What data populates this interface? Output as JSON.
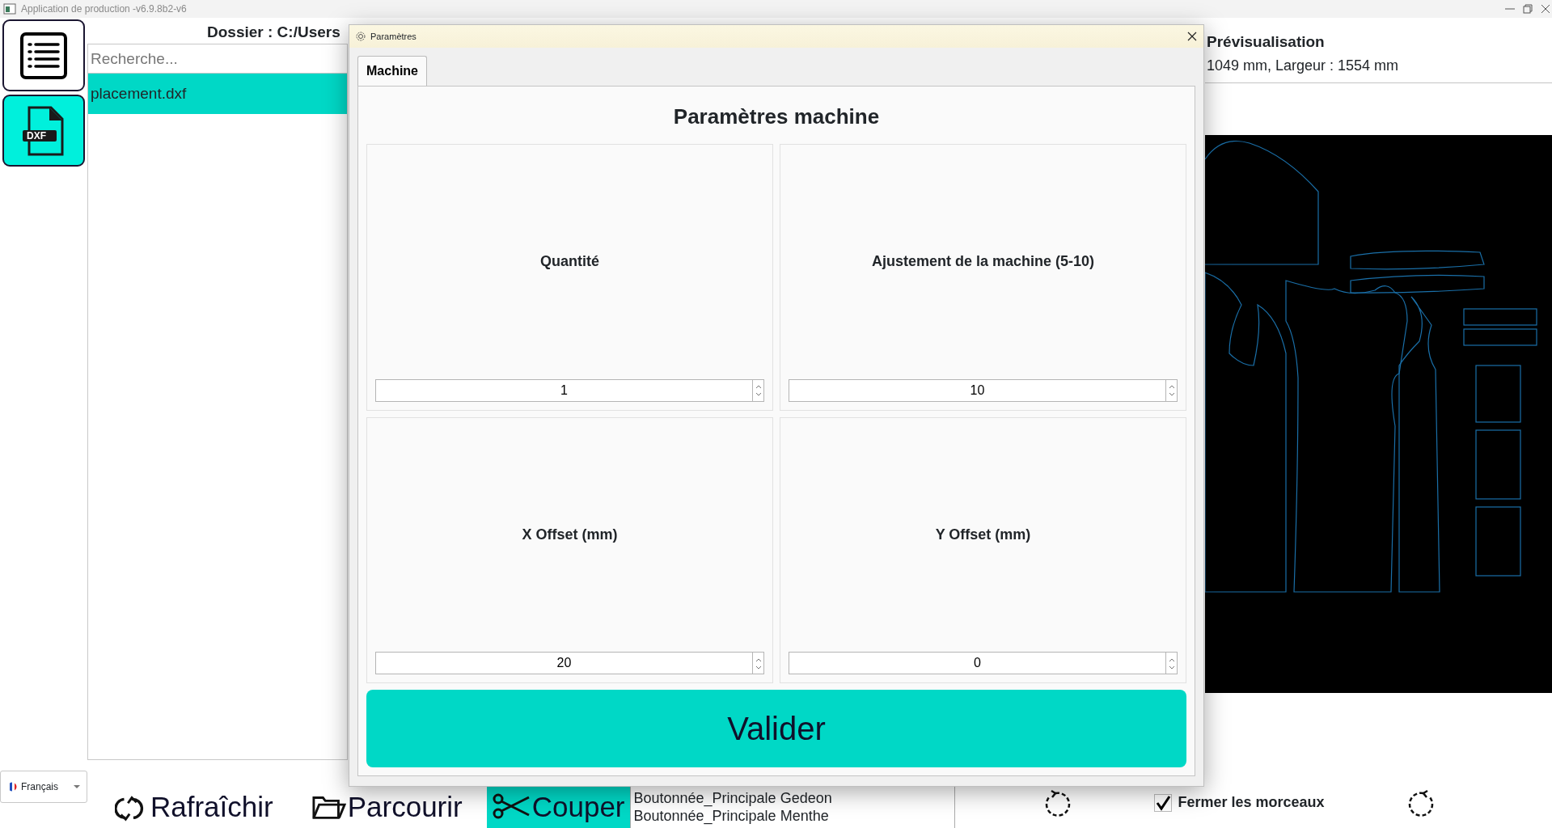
{
  "window": {
    "title": "Application de production -v6.9.8b2-v6"
  },
  "sidebar": {
    "buttons": [
      {
        "kind": "list",
        "selected": false
      },
      {
        "kind": "dxf",
        "label": "DXF",
        "selected": true
      }
    ]
  },
  "files": {
    "header": "Dossier : C:/Users",
    "search": {
      "placeholder": "Recherche..."
    },
    "items": [
      {
        "name": "placement.dxf",
        "selected": true
      }
    ]
  },
  "preview": {
    "title": "Prévisualisation",
    "dimensions": "1049 mm, Largeur : 1554 mm"
  },
  "dialog": {
    "title": "Paramètres",
    "tabs": [
      {
        "label": "Machine",
        "selected": true
      }
    ],
    "heading": "Paramètres machine",
    "fields": [
      {
        "label": "Quantité",
        "value": "1"
      },
      {
        "label": "Ajustement de la machine (5-10)",
        "value": "10"
      },
      {
        "label": "X Offset (mm)",
        "value": "20"
      },
      {
        "label": "Y Offset (mm)",
        "value": "0"
      }
    ],
    "submit": "Valider"
  },
  "bottom_bar": {
    "language": "Français",
    "buttons": [
      {
        "kind": "refresh",
        "label": "Rafraîchir",
        "selected": false
      },
      {
        "kind": "browse",
        "label": "Parcourir",
        "selected": false
      },
      {
        "kind": "cut",
        "label": "Couper",
        "selected": true
      }
    ],
    "pieces": [
      "Boutonnée_Principale Gedeon",
      "Boutonnée_Principale Menthe"
    ],
    "close_pieces": {
      "label": "Fermer les morceaux",
      "checked": true
    }
  }
}
